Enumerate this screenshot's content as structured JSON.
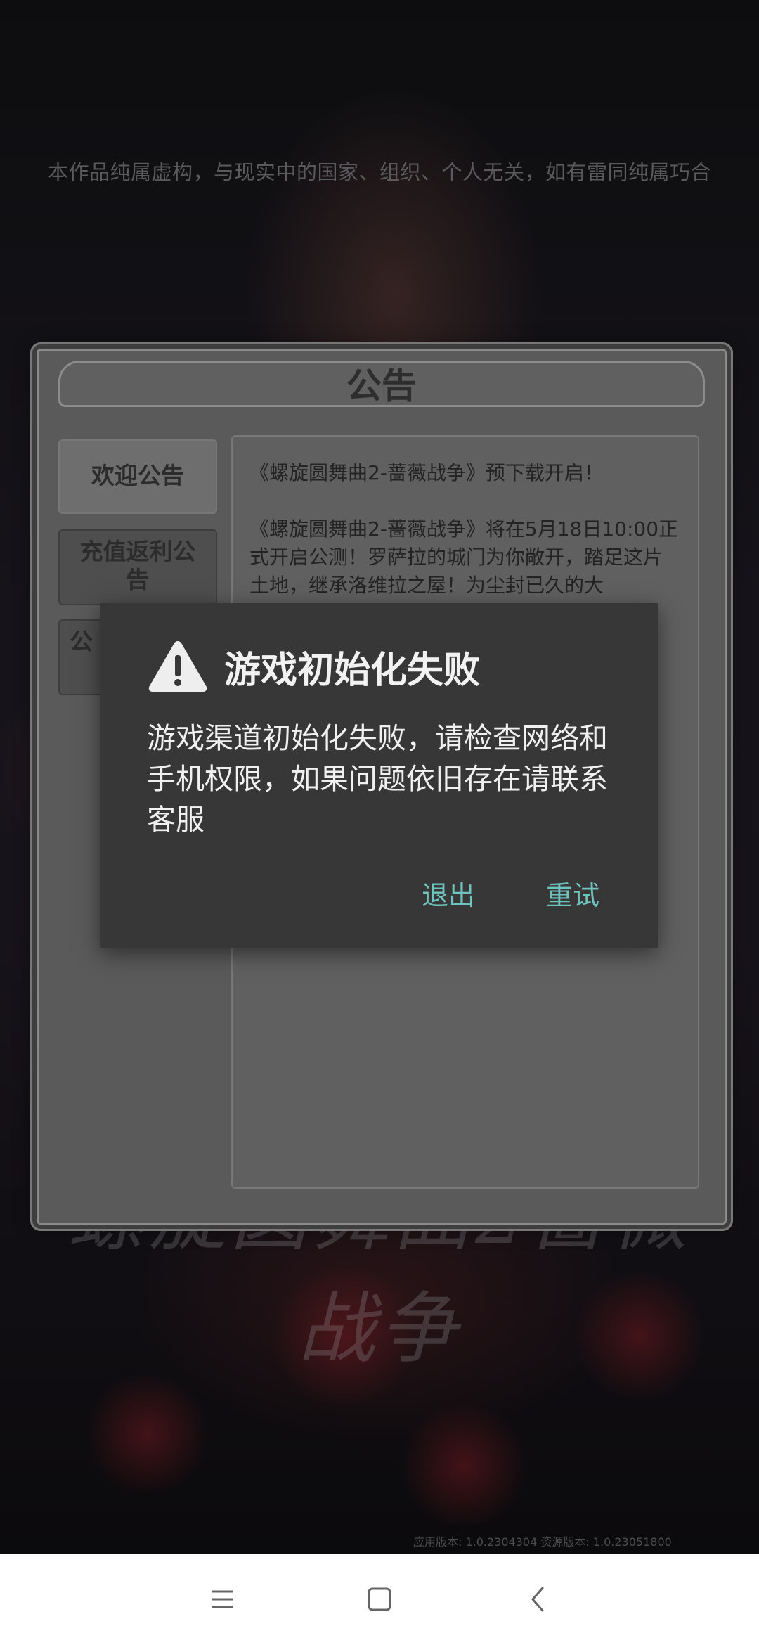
{
  "game": {
    "disclaimer": "本作品纯属虚构，与现实中的国家、组织、个人无关，如有雷同纯属巧合",
    "logo_text": "螺旋圆舞曲2蔷薇战争",
    "version": "应用版本: 1.0.2304304 资源版本: 1.0.23051800"
  },
  "notice": {
    "title": "公告",
    "tabs": [
      {
        "label": "欢迎公告",
        "active": true
      },
      {
        "label": "充值返利公告",
        "active": false
      },
      {
        "label": "公",
        "active": false
      }
    ],
    "content": {
      "heading": "《螺旋圆舞曲2-蔷薇战争》预下载开启！",
      "body": "《螺旋圆舞曲2-蔷薇战争》将在5月18日10:00正式开启公测！罗萨拉的城门为你敞开，踏足这片土地，继承洛维拉之屋！为尘封已久的大"
    }
  },
  "dialog": {
    "title": "游戏初始化失败",
    "message": "游戏渠道初始化失败，请检查网络和手机权限，如果问题依旧存在请联系客服",
    "exit_label": "退出",
    "retry_label": "重试",
    "accent_color": "#6fc3be"
  },
  "navbar": {
    "icons": [
      "menu-icon",
      "home-icon",
      "back-icon"
    ]
  }
}
